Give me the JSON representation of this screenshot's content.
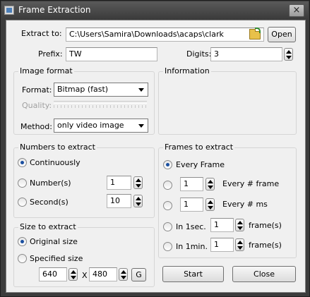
{
  "window": {
    "title": "Frame Extraction",
    "close_glyph": "×"
  },
  "extract_to": {
    "label": "Extract to:",
    "value": "C:\\Users\\Samira\\Downloads\\acaps\\clark",
    "browse_icon": "folder-open-icon",
    "open_label": "Open"
  },
  "prefix": {
    "label": "Prefix:",
    "value": "TW"
  },
  "digits": {
    "label": "Digits:",
    "value": "3"
  },
  "image_format": {
    "title": "Image format",
    "format_label": "Format:",
    "format_value": "Bitmap (fast)",
    "quality_label": "Quality:",
    "method_label": "Method:",
    "method_value": "only video image"
  },
  "information": {
    "title": "Information"
  },
  "numbers": {
    "title": "Numbers to extract",
    "continuously": "Continuously",
    "numbers_label": "Number(s)",
    "numbers_value": "1",
    "seconds_label": "Second(s)",
    "seconds_value": "10",
    "selected": "continuously"
  },
  "frames": {
    "title": "Frames to extract",
    "every_frame": "Every Frame",
    "every_n_frame_value": "1",
    "every_n_frame_label": "Every # frame",
    "every_n_ms_value": "1",
    "every_n_ms_label": "Every # ms",
    "in_1sec_label": "In 1sec.",
    "in_1sec_value": "1",
    "in_1sec_unit": "frame(s)",
    "in_1min_label": "In 1min.",
    "in_1min_value": "1",
    "in_1min_unit": "frame(s)",
    "selected": "every_frame"
  },
  "size": {
    "title": "Size to extract",
    "original": "Original size",
    "specified": "Specified size",
    "width": "640",
    "x_label": "X",
    "height": "480",
    "g_label": "G",
    "selected": "original"
  },
  "actions": {
    "start": "Start",
    "close": "Close"
  }
}
